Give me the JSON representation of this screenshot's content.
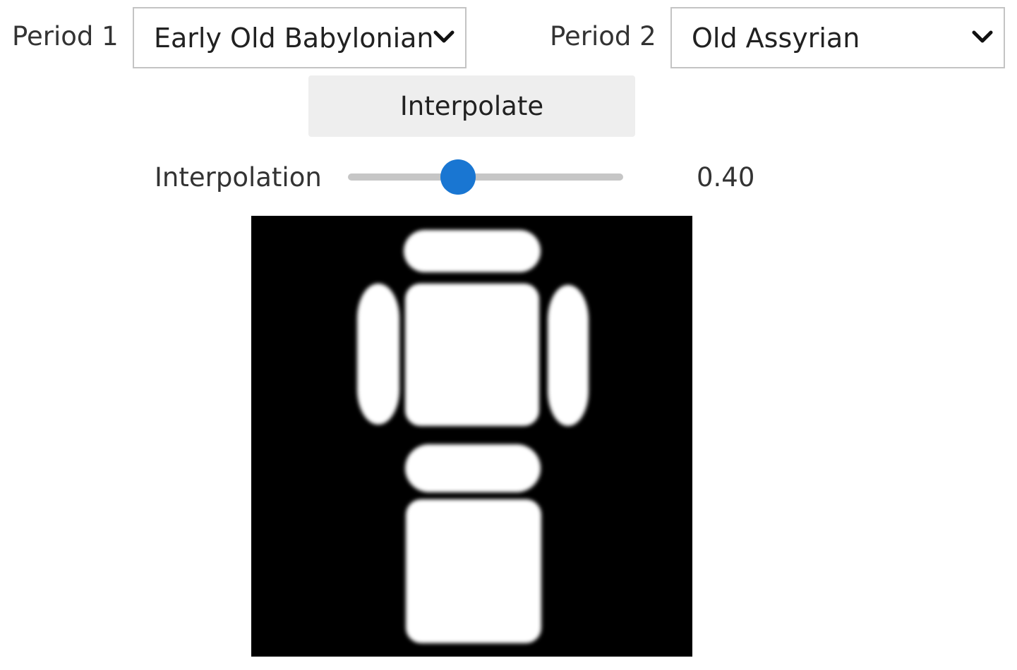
{
  "controls": {
    "period1": {
      "label": "Period 1",
      "selected": "Early Old Babylonian"
    },
    "period2": {
      "label": "Period 2",
      "selected": "Old Assyrian"
    },
    "interpolate_button": "Interpolate",
    "interpolation": {
      "label": "Interpolation",
      "value": 0.4,
      "value_text": "0.40",
      "min": 0,
      "max": 1
    }
  },
  "icons": {
    "dropdown": "chevron-down-icon"
  },
  "colors": {
    "slider_accent": "#1976d2",
    "slider_track": "#c6c6c6",
    "button_bg": "#eeeeee",
    "image_bg": "#000000",
    "glyph_fill": "#ffffff"
  }
}
